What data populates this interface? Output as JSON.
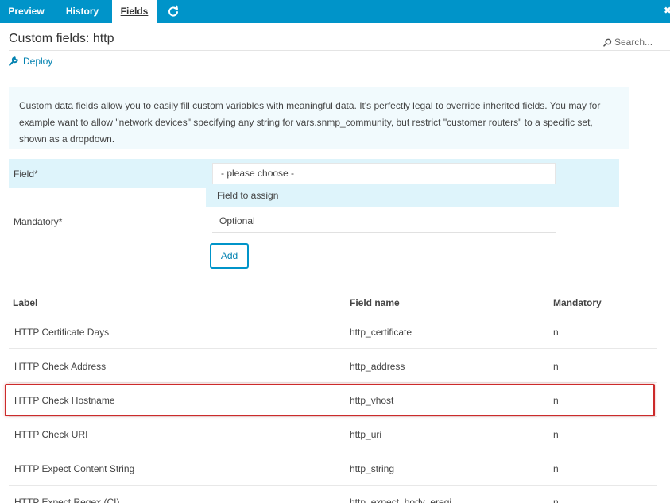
{
  "tabs": [
    {
      "label": "Preview"
    },
    {
      "label": "History"
    },
    {
      "label": "Fields"
    }
  ],
  "header": {
    "title": "Custom fields: http",
    "search_placeholder": "Search..."
  },
  "actions": {
    "deploy_label": "Deploy"
  },
  "info_text": "Custom data fields allow you to easily fill custom variables with meaningful data. It's perfectly legal to override inherited fields. You may for example want to allow \"network devices\" specifying any string for vars.snmp_community, but restrict \"customer routers\" to a specific set, shown as a dropdown.",
  "form": {
    "field_label": "Field*",
    "field_value": "- please choose -",
    "field_hint": "Field to assign",
    "mandatory_label": "Mandatory*",
    "mandatory_value": "Optional",
    "add_label": "Add"
  },
  "table": {
    "headers": [
      "Label",
      "Field name",
      "Mandatory"
    ],
    "rows": [
      {
        "label": "HTTP Certificate Days",
        "field": "http_certificate",
        "mandatory": "n"
      },
      {
        "label": "HTTP Check Address",
        "field": "http_address",
        "mandatory": "n"
      },
      {
        "label": "HTTP Check Hostname",
        "field": "http_vhost",
        "mandatory": "n"
      },
      {
        "label": "HTTP Check URI",
        "field": "http_uri",
        "mandatory": "n"
      },
      {
        "label": "HTTP Expect Content String",
        "field": "http_string",
        "mandatory": "n"
      },
      {
        "label": "HTTP Expect Regex (CI)",
        "field": "http_expect_body_eregi",
        "mandatory": "n"
      }
    ]
  },
  "colors": {
    "tabbar": "#0094c9",
    "link": "#0081b0",
    "info_bg": "#f1fafd",
    "active_field_bg": "#def4fb",
    "highlight_border": "#cc2a2a"
  }
}
